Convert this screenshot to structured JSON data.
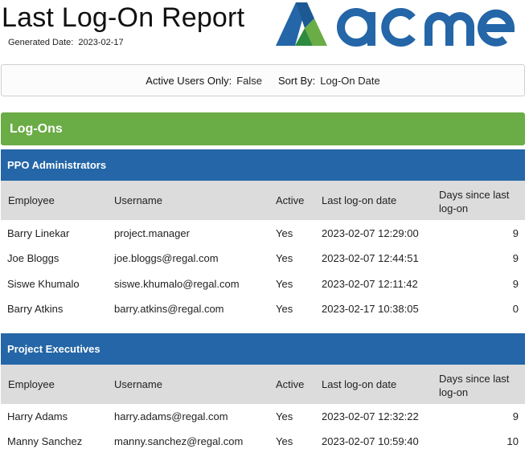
{
  "report": {
    "title": "Last Log-On Report",
    "generated_label": "Generated Date:",
    "generated_value": "2023-02-17",
    "logo_alt": "acme-logo"
  },
  "filters": {
    "active_label": "Active Users Only:",
    "active_value": "False",
    "sort_label": "Sort By:",
    "sort_value": "Log-On Date"
  },
  "section": {
    "title": "Log-Ons"
  },
  "columns": {
    "employee": "Employee",
    "username": "Username",
    "active": "Active",
    "last": "Last log-on date",
    "days": "Days since last log-on"
  },
  "groups": [
    {
      "name": "PPO Administrators",
      "rows": [
        {
          "employee": "Barry Linekar",
          "username": "project.manager",
          "active": "Yes",
          "last": "2023-02-07 12:29:00",
          "days": "9"
        },
        {
          "employee": "Joe Bloggs",
          "username": "joe.bloggs@regal.com",
          "active": "Yes",
          "last": "2023-02-07 12:44:51",
          "days": "9"
        },
        {
          "employee": "Siswe Khumalo",
          "username": "siswe.khumalo@regal.com",
          "active": "Yes",
          "last": "2023-02-07 12:11:42",
          "days": "9"
        },
        {
          "employee": "Barry Atkins",
          "username": "barry.atkins@regal.com",
          "active": "Yes",
          "last": "2023-02-17 10:38:05",
          "days": "0"
        }
      ]
    },
    {
      "name": "Project Executives",
      "rows": [
        {
          "employee": "Harry Adams",
          "username": "harry.adams@regal.com",
          "active": "Yes",
          "last": "2023-02-07 12:32:22",
          "days": "9"
        },
        {
          "employee": "Manny Sanchez",
          "username": "manny.sanchez@regal.com",
          "active": "Yes",
          "last": "2023-02-07 10:59:40",
          "days": "10"
        }
      ]
    }
  ],
  "colors": {
    "brand_blue": "#2466a7",
    "brand_green": "#6aac45",
    "header_gray": "#dcdcdc"
  }
}
